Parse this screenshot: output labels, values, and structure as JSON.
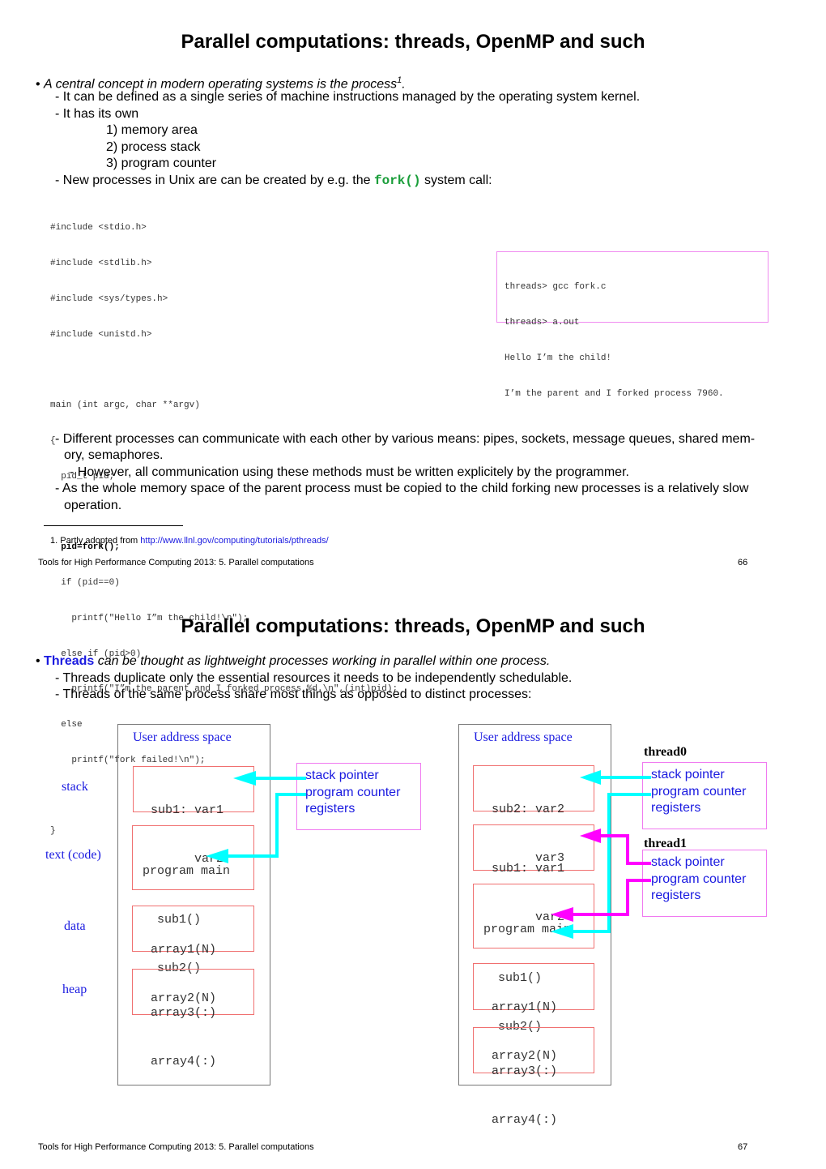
{
  "page66": {
    "title": "Parallel computations: threads, OpenMP and such",
    "bullet_intro": "A central concept in modern operating systems is the process",
    "bullet_intro_sup": "1",
    "bullet_intro_end": ".",
    "lines": [
      "- It can be defined as a single series of machine instructions managed by the operating system kernel.",
      "- It has its own"
    ],
    "own_items": [
      "1) memory area",
      "2) process stack",
      "3) program counter"
    ],
    "fork_line_pre": "- New processes in Unix are can be created by e.g. the ",
    "fork_line_code": "fork()",
    "fork_line_post": " system call:",
    "code_lines": [
      "#include <stdio.h>",
      "#include <stdlib.h>",
      "#include <sys/types.h>",
      "#include <unistd.h>",
      "",
      "main (int argc, char **argv)",
      "{",
      "  pid_t pid;",
      "",
      "  pid=fork();",
      "  if (pid==0)",
      "    printf(\"Hello I”m the child!\\n\");",
      "  else if (pid>0)",
      "    printf(\"I”m the parent and I forked process %d.\\n\",(int)pid);",
      "  else",
      "    printf(\"fork failed!\\n\");",
      "",
      "}"
    ],
    "terminal_lines": [
      "threads> gcc fork.c",
      "threads> a.out",
      "Hello I’m the child!",
      "I’m the parent and I forked process 7960."
    ],
    "comm_lines": [
      "- Different processes can communicate with each other by various means: pipes, sockets, message queues, shared mem-",
      "ory, semaphores.",
      "- However, all communication using these methods must be written explicitely by the programmer.",
      "- As the whole memory space of the parent process must be copied to the child forking new processes is a relatively slow",
      "operation."
    ],
    "footnote_prefix": "1.  Partly adopted from ",
    "footnote_link": "http://www.llnl.gov/computing/tutorials/pthreads/",
    "footer_text": "Tools for High Performance Computing 2013:   5. Parallel computations",
    "page_number": "66"
  },
  "page67": {
    "title": "Parallel computations: threads, OpenMP and such",
    "bullet_strong": "Threads",
    "bullet_rest": " can be thought as lightweight processes working in parallel within one process.",
    "lines": [
      "- Threads duplicate only the essential resources it needs to be independently schedulable.",
      "- Threads of the same process share most things as opposed to distinct processes:"
    ],
    "diagram": {
      "segment_labels": [
        "stack",
        "text (code)",
        "data",
        "heap"
      ],
      "left": {
        "space_label": "User address space",
        "stack_box": [
          "sub1: var1",
          "      var2"
        ],
        "code_box": [
          "program main",
          "  sub1()",
          "  sub2()"
        ],
        "data_box": [
          "array1(N)",
          "array2(N)"
        ],
        "heap_box": [
          "array3(:)",
          "array4(:)"
        ],
        "registers": [
          "stack pointer",
          "program counter",
          "registers"
        ]
      },
      "right": {
        "space_label": "User address space",
        "stack_box_a": [
          "sub2: var2",
          "      var3"
        ],
        "stack_box_b": [
          "sub1: var1",
          "      var2"
        ],
        "code_box": [
          "program main",
          "  sub1()",
          "  sub2()"
        ],
        "data_box": [
          "array1(N)",
          "array2(N)"
        ],
        "heap_box": [
          "array3(:)",
          "array4(:)"
        ],
        "thread0_label": "thread0",
        "thread0_registers": [
          "stack pointer",
          "program counter",
          "registers"
        ],
        "thread1_label": "thread1",
        "thread1_registers": [
          "stack pointer",
          "program counter",
          "registers"
        ]
      },
      "colors": {
        "thread0_arrow": "#00ffff",
        "thread1_arrow": "#ff00ff",
        "label_blue": "#1a1ae0",
        "segment_border": "#f07070",
        "register_border": "#f07af0"
      }
    },
    "footer_text": "Tools for High Performance Computing 2013:   5. Parallel computations",
    "page_number": "67"
  }
}
